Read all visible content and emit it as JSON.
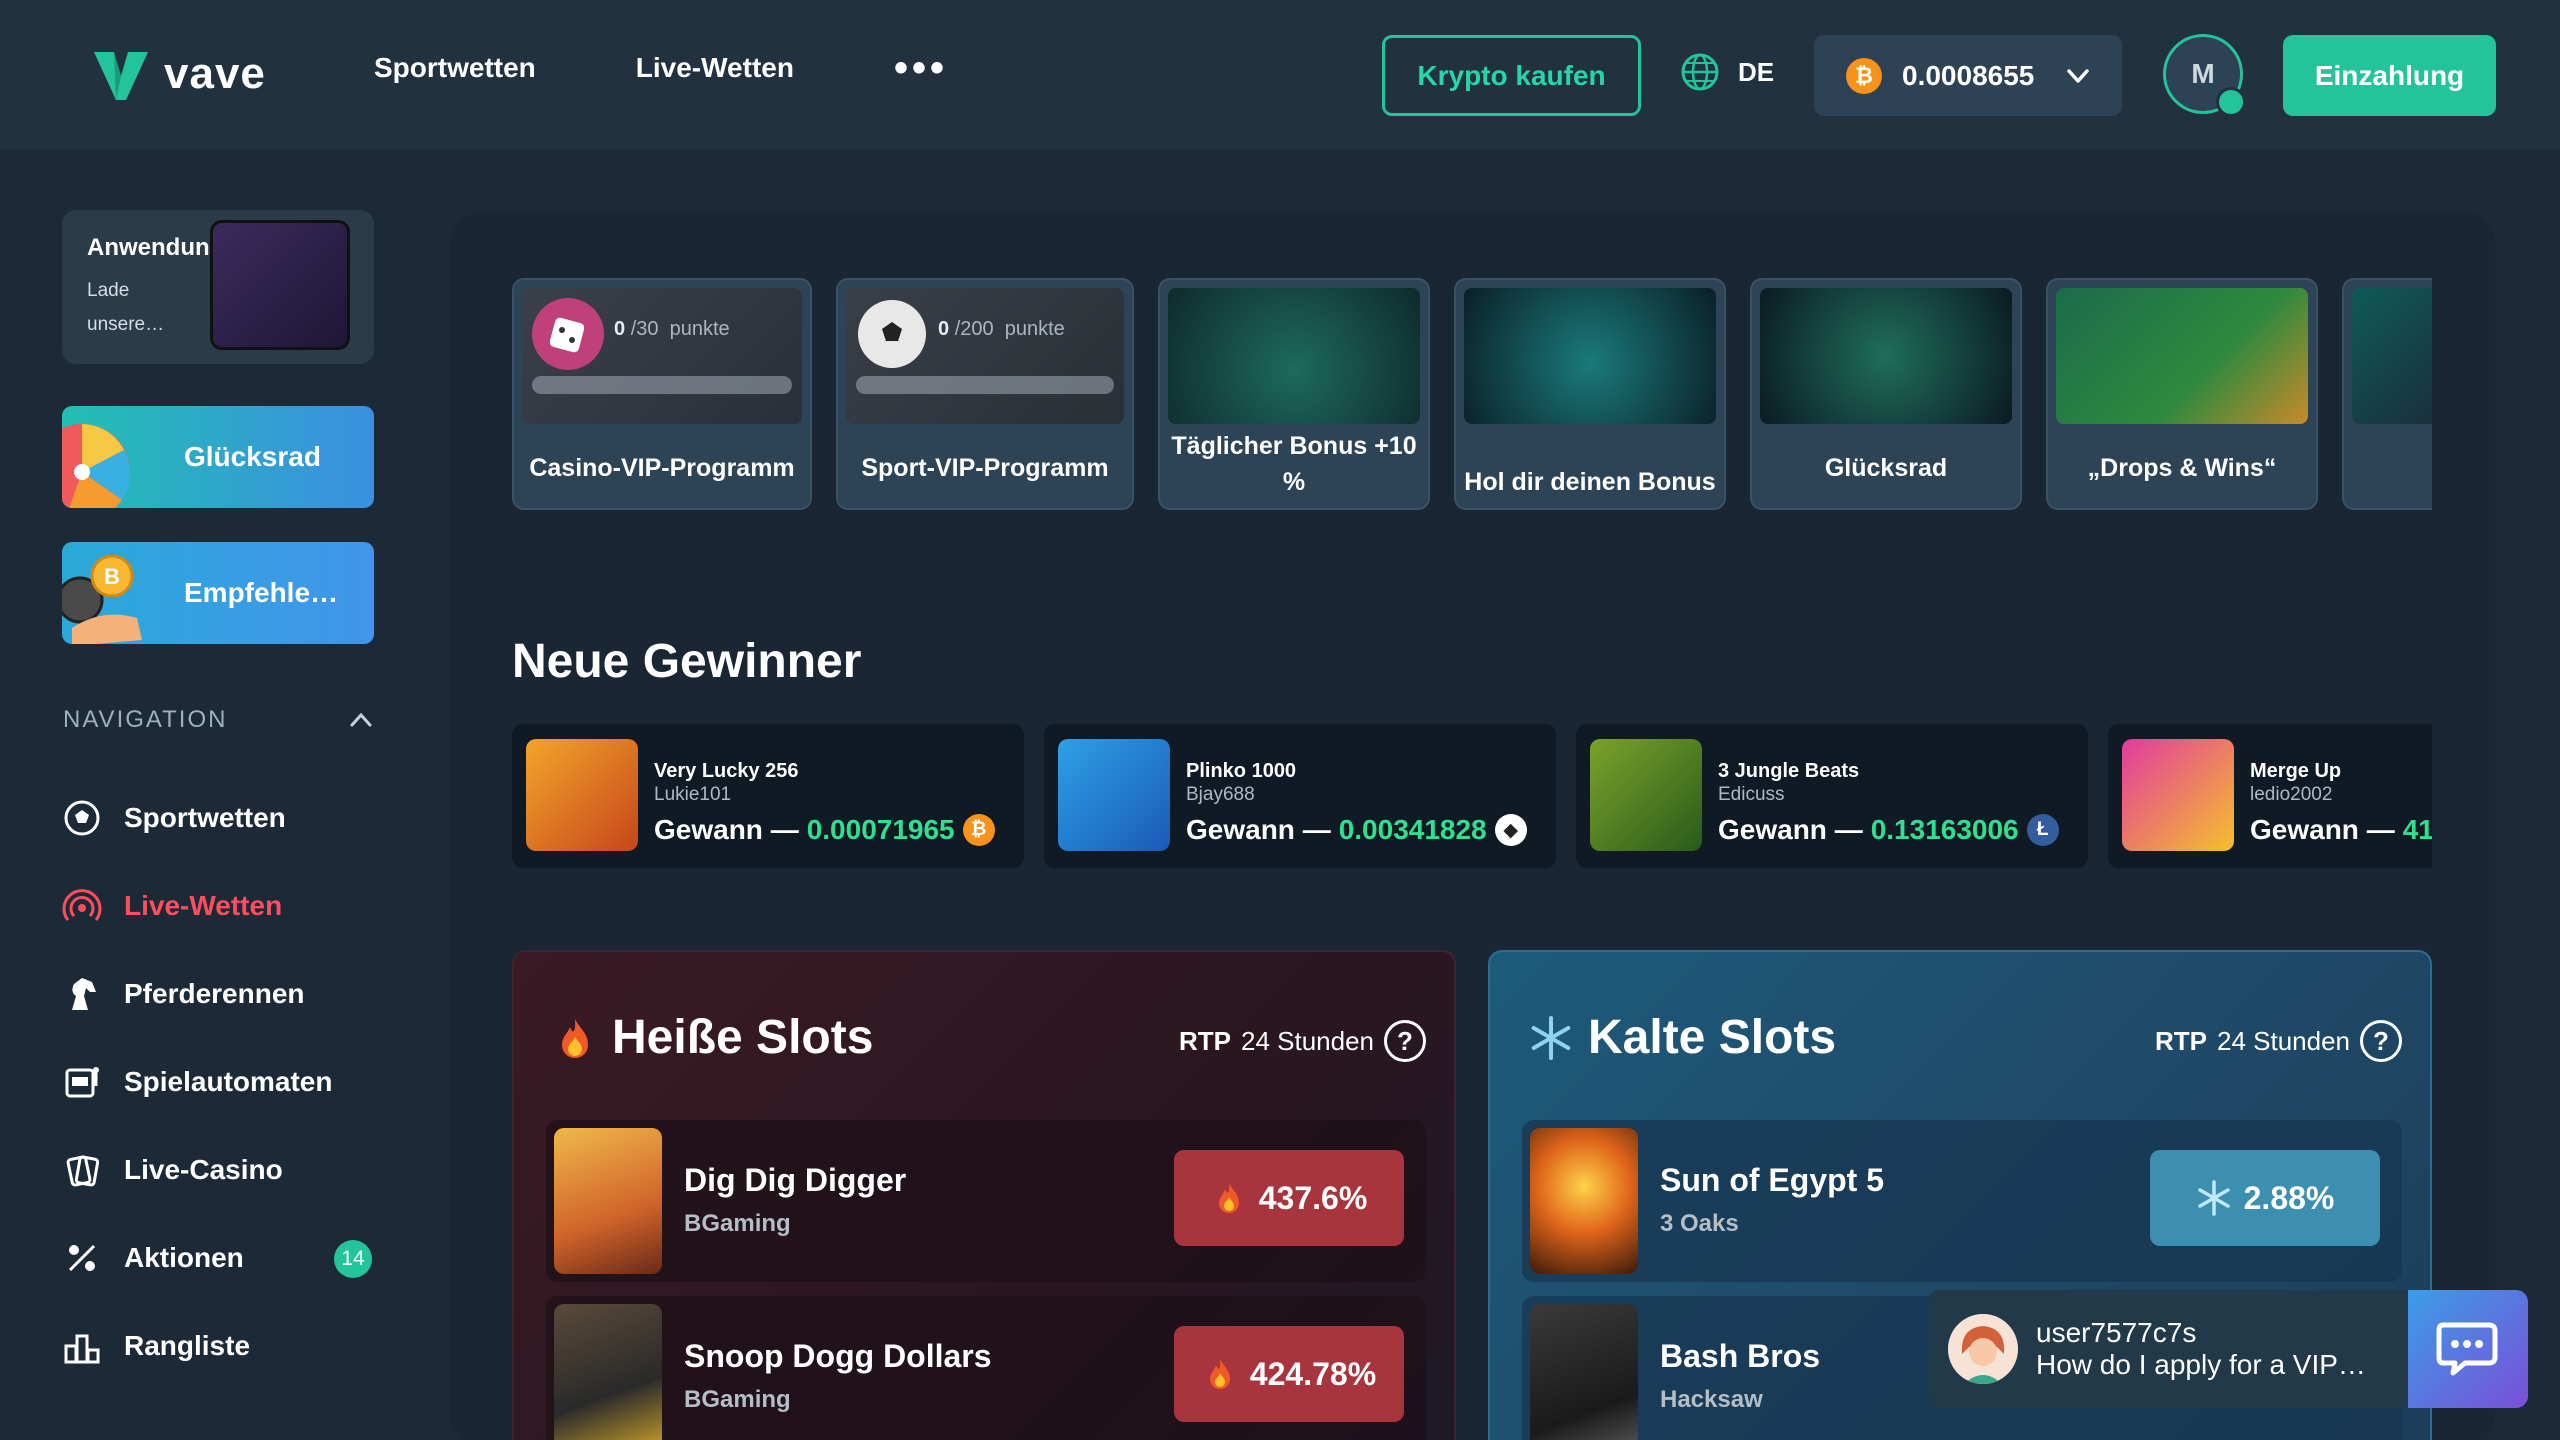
{
  "header": {
    "logo_text": "vave",
    "nav": [
      "Sportwetten",
      "Live-Wetten"
    ],
    "more": "•••",
    "buy_crypto": "Krypto kaufen",
    "language": "DE",
    "balance": "0.0008655",
    "balance_coin_symbol": "₿",
    "avatar_initial": "M",
    "deposit": "Einzahlung",
    "accent_color": "#24c49a"
  },
  "sidebar": {
    "app": {
      "title": "Anwendung",
      "subtitle": "Lade unsere…"
    },
    "wheel_button": "Glücksrad",
    "referral_button": "Empfehle…",
    "nav_heading": "NAVIGATION",
    "items": [
      {
        "label": "Sportwetten",
        "icon": "soccer-ball-icon"
      },
      {
        "label": "Live-Wetten",
        "icon": "live-signal-icon"
      },
      {
        "label": "Pferderennen",
        "icon": "horse-icon"
      },
      {
        "label": "Spielautomaten",
        "icon": "slot-machine-icon"
      },
      {
        "label": "Live-Casino",
        "icon": "cards-icon"
      },
      {
        "label": "Aktionen",
        "icon": "gift-icon",
        "badge": "14"
      },
      {
        "label": "Rangliste",
        "icon": "leaderboard-icon"
      }
    ]
  },
  "promos": [
    {
      "label": "Casino-VIP-Programm",
      "points": "0",
      "max": "/30",
      "unit": "punkte"
    },
    {
      "label": "Sport-VIP-Programm",
      "points": "0",
      "max": "/200",
      "unit": "punkte"
    },
    {
      "label": "Täglicher Bonus +10 %"
    },
    {
      "label": "Hol dir deinen Bonus"
    },
    {
      "label": "Glücksrad"
    },
    {
      "label": "„Drops & Wins“"
    }
  ],
  "winners": {
    "title": "Neue Gewinner",
    "win_label": "Gewann —",
    "items": [
      {
        "game": "Very Lucky 256",
        "user": "Lukie101",
        "amount": "0.00071965",
        "coin": "₿",
        "coin_color": "#f7931a"
      },
      {
        "game": "Plinko 1000",
        "user": "Bjay688",
        "amount": "0.00341828",
        "coin": "◆",
        "coin_color": "#ffffff"
      },
      {
        "game": "3 Jungle Beats",
        "user": "Edicuss",
        "amount": "0.13163006",
        "coin": "Ł",
        "coin_color": "#345d9d"
      },
      {
        "game": "Merge Up",
        "user": "ledio2002",
        "amount": "41",
        "coin": "",
        "coin_color": ""
      }
    ]
  },
  "hot_slots": {
    "title": "Heiße Slots",
    "rtp_label": "RTP",
    "rtp_period": "24 Stunden",
    "help": "?",
    "items": [
      {
        "name": "Dig Dig Digger",
        "provider": "BGaming",
        "value": "437.6%"
      },
      {
        "name": "Snoop Dogg Dollars",
        "provider": "BGaming",
        "value": "424.78%"
      }
    ]
  },
  "cold_slots": {
    "title": "Kalte Slots",
    "rtp_label": "RTP",
    "rtp_period": "24 Stunden",
    "help": "?",
    "items": [
      {
        "name": "Sun of Egypt 5",
        "provider": "3 Oaks",
        "value": "2.88%"
      },
      {
        "name": "Bash Bros",
        "provider": "Hacksaw",
        "value": ""
      }
    ]
  },
  "chat": {
    "user": "user7577c7s",
    "message": "How do I apply for a VIP…"
  }
}
